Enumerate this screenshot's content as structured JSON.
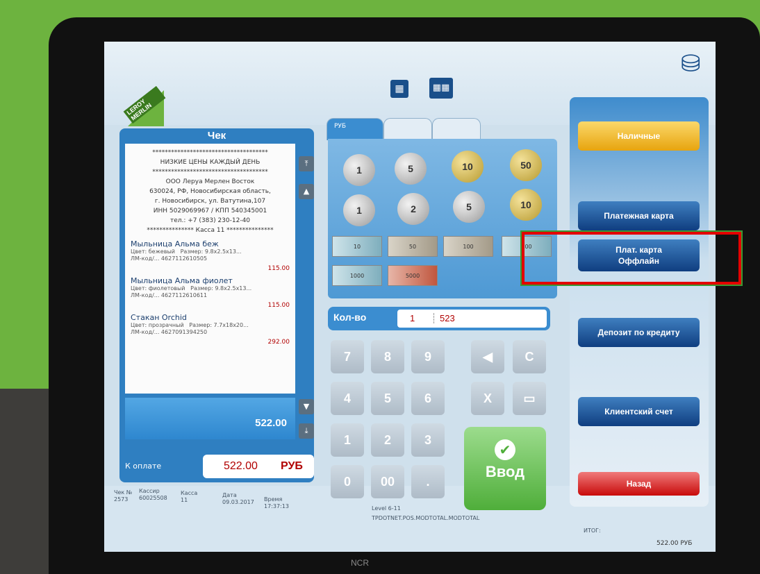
{
  "receipt": {
    "title": "Чек",
    "header_lines": [
      "*************************************",
      "НИЗКИЕ ЦЕНЫ КАЖДЫЙ ДЕНЬ",
      "*************************************",
      "ООО Леруа Мерлен Восток",
      "630024, РФ, Новосибирская область,",
      "г. Новосибирск, ул. Ватутина,107",
      "ИНН 5029069967 / КПП 540345001",
      "тел.: +7 (383) 230-12-40",
      "*************** Касса 11 ***************"
    ],
    "items": [
      {
        "name": "Мыльница Альма беж",
        "color": "Цвет: бежевый",
        "size": "Размер: 9.8x2.5x13...",
        "code": "ЛМ-код/... 4627112610505",
        "price": "115.00"
      },
      {
        "name": "Мыльница Альма фиолет",
        "color": "Цвет: фиолетовый",
        "size": "Размер: 9.8x2.5x13...",
        "code": "ЛМ-код/... 4627112610611",
        "price": "115.00"
      },
      {
        "name": "Стакан Orchid",
        "color": "Цвет: прозрачный",
        "size": "Размер: 7.7x18x20...",
        "code": "ЛМ-код/... 4627091394250",
        "price": "292.00"
      }
    ],
    "selected_total": "522.00",
    "to_pay_label": "К оплате",
    "to_pay_value": "522.00",
    "currency": "РУБ"
  },
  "footer": {
    "check_no_label": "Чек №",
    "check_no": "2573",
    "cashier_label": "Кассир",
    "cashier": "60025508",
    "register_label": "Касса",
    "register": "11",
    "date_label": "Дата",
    "date": "09.03.2017",
    "time_label": "Время",
    "time": "17:37:13",
    "level": "Level 6-11",
    "module": "TPDOTNET.POS.MODTOTAL.MODTOTAL",
    "total_label": "ИТОГ:",
    "total_value": "522.00 РУБ"
  },
  "currency_tab": "РУБ",
  "coins": [
    "1",
    "5",
    "10",
    "50",
    "1",
    "2",
    "5",
    "10"
  ],
  "notes": [
    "10",
    "50",
    "100",
    "500",
    "1000",
    "5000"
  ],
  "qty": {
    "label": "Кол-во",
    "qty": "1",
    "code": "523"
  },
  "keypad": [
    "7",
    "8",
    "9",
    "◀",
    "C",
    "4",
    "5",
    "6",
    "X",
    "▭",
    "1",
    "2",
    "3",
    "0",
    "00",
    "."
  ],
  "enter_label": "Ввод",
  "payment_buttons": {
    "cash": "Наличные",
    "card": "Платежная карта",
    "card_offline_1": "Плат. карта",
    "card_offline_2": "Оффлайн",
    "deposit": "Депозит по кредиту",
    "client": "Клиентский счет",
    "back": "Назад"
  },
  "brand": {
    "logo": "LEROY MERLIN",
    "device": "NCR"
  }
}
